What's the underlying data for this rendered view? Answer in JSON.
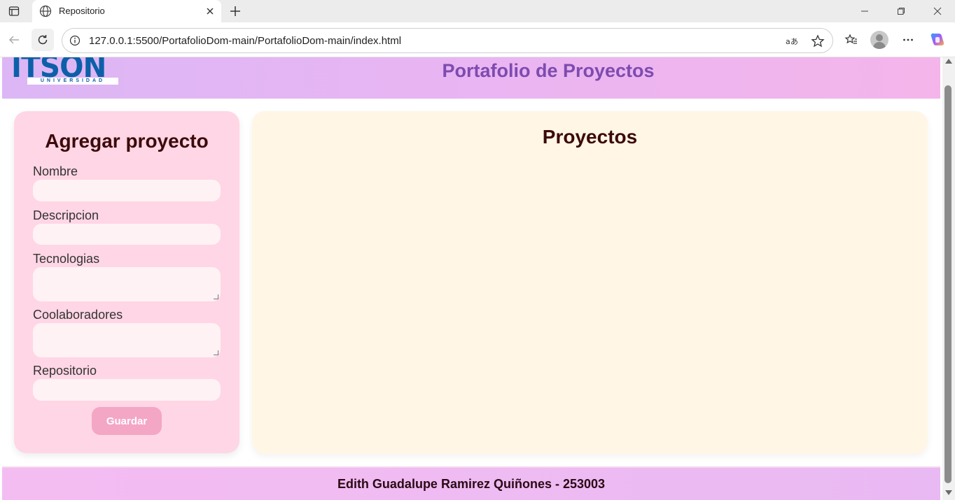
{
  "browser": {
    "tab_title": "Repositorio",
    "url": "127.0.0.1:5500/PortafolioDom-main/PortafolioDom-main/index.html"
  },
  "header": {
    "logo_text": "ITSON",
    "logo_sub": "UNIVERSIDAD",
    "title": "Portafolio de Proyectos"
  },
  "form": {
    "title": "Agregar proyecto",
    "fields": [
      {
        "label": "Nombre",
        "value": ""
      },
      {
        "label": "Descripcion",
        "value": ""
      },
      {
        "label": "Tecnologias",
        "value": ""
      },
      {
        "label": "Coolaboradores",
        "value": ""
      },
      {
        "label": "Repositorio",
        "value": ""
      }
    ],
    "submit_label": "Guardar"
  },
  "projects": {
    "title": "Proyectos",
    "items": []
  },
  "footer": {
    "text": "Edith Guadalupe Ramirez Quiñones - 253003"
  },
  "colors": {
    "header_gradient_start": "#dcb6f5",
    "header_gradient_end": "#f4b5ea",
    "header_title": "#7d4bb0",
    "form_card": "#ffd6e5",
    "projects_card": "#fff6e6",
    "button": "#f4a6c5",
    "logo": "#0d5fa9"
  }
}
